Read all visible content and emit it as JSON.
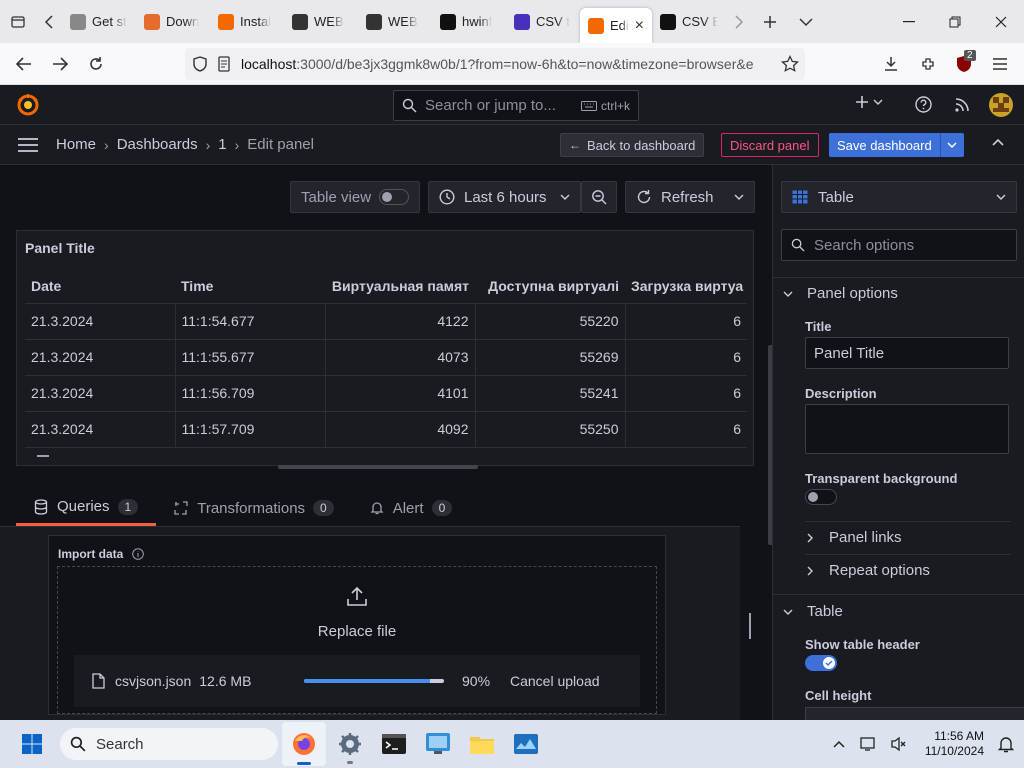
{
  "browser": {
    "tabs": [
      {
        "label": "Get st",
        "fav_color": "#888"
      },
      {
        "label": "Down",
        "fav_color": "#e66b2e"
      },
      {
        "label": "Instal",
        "fav_color": "#f46800"
      },
      {
        "label": "WEB",
        "fav_color": "#333"
      },
      {
        "label": "WEB",
        "fav_color": "#333"
      },
      {
        "label": "hwinf",
        "fav_color": "#111"
      },
      {
        "label": "CSV t",
        "fav_color": "#4a2fbd"
      },
      {
        "label": "Edi",
        "fav_color": "#f46800",
        "active": true
      },
      {
        "label": "CSV E",
        "fav_color": "#111"
      }
    ],
    "url_host": "localhost",
    "url_rest": ":3000/d/be3jx3ggmk8w0b/1?from=now-6h&to=now&timezone=browser&e",
    "ext_badge": "2"
  },
  "grafana": {
    "search_placeholder": "Search or jump to...",
    "search_shortcut": "ctrl+k",
    "breadcrumbs": [
      "Home",
      "Dashboards",
      "1",
      "Edit panel"
    ],
    "back_button": "Back to dashboard",
    "discard_button": "Discard panel",
    "save_button": "Save dashboard",
    "table_view_label": "Table view",
    "time_range": "Last 6 hours",
    "refresh_label": "Refresh",
    "panel_title": "Panel Title",
    "table": {
      "columns": [
        "Date",
        "Time",
        "Виртуальная памят",
        "Доступна виртуалі",
        "Загрузка виртуа"
      ],
      "rows": [
        [
          "21.3.2024",
          "11:1:54.677",
          "4122",
          "55220",
          "6"
        ],
        [
          "21.3.2024",
          "11:1:55.677",
          "4073",
          "55269",
          "6"
        ],
        [
          "21.3.2024",
          "11:1:56.709",
          "4101",
          "55241",
          "6"
        ],
        [
          "21.3.2024",
          "11:1:57.709",
          "4092",
          "55250",
          "6"
        ]
      ]
    },
    "query_tabs": [
      {
        "label": "Queries",
        "count": "1"
      },
      {
        "label": "Transformations",
        "count": "0"
      },
      {
        "label": "Alert",
        "count": "0"
      }
    ],
    "import_label": "Import data",
    "replace_label": "Replace file",
    "file_name": "csvjson.json",
    "file_size": "12.6 MB",
    "progress_text": "90%",
    "progress_value": 0.9,
    "cancel_upload": "Cancel upload",
    "viz_type": "Table",
    "search_options_placeholder": "Search options",
    "options": {
      "panel_options": "Panel options",
      "title_label": "Title",
      "title_value": "Panel Title",
      "description_label": "Description",
      "transparent_label": "Transparent background",
      "panel_links": "Panel links",
      "repeat_options": "Repeat options",
      "table_section": "Table",
      "show_header_label": "Show table header",
      "cell_height_label": "Cell height"
    }
  },
  "taskbar": {
    "search_placeholder": "Search",
    "time": "11:56 AM",
    "date": "11/10/2024"
  }
}
